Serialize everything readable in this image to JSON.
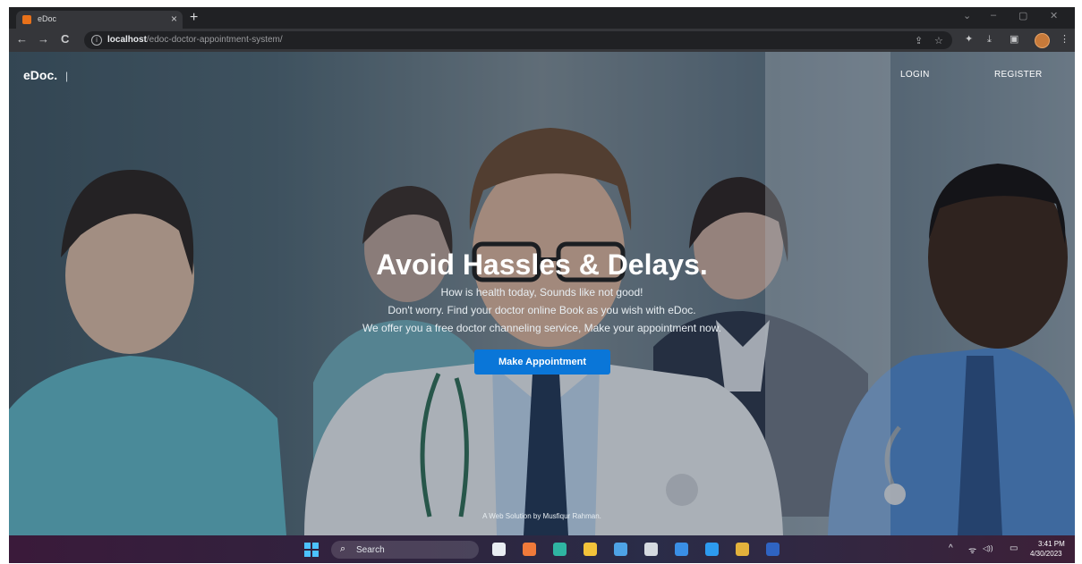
{
  "browser": {
    "tab": {
      "title": "eDoc",
      "close_glyph": "×"
    },
    "new_tab_glyph": "+",
    "window_controls": [
      "⌄",
      "–",
      "▢",
      "✕"
    ],
    "nav": {
      "back_glyph": "←",
      "forward_glyph": "→",
      "reload_glyph": "C"
    },
    "url": {
      "host": "localhost",
      "path": "/edoc-doctor-appointment-system/"
    },
    "toolbar_icons": [
      "share-icon",
      "star-icon",
      "extensions-icon",
      "download-icon",
      "sidebar-icon",
      "profile-avatar",
      "menu-icon"
    ]
  },
  "site": {
    "brand": "eDoc.",
    "brand_separator": "|",
    "nav": {
      "login": "LOGIN",
      "register": "REGISTER"
    },
    "hero": {
      "title": "Avoid Hassles & Delays.",
      "lines": [
        "How is health today, Sounds like not good!",
        "Don't worry. Find your doctor online Book as you wish with eDoc.",
        "We offer you a free doctor channeling service, Make your appointment now."
      ],
      "cta_label": "Make Appointment"
    },
    "footer_credit": "A Web Solution by Musfiqur Rahman."
  },
  "taskbar": {
    "search_label": "Search",
    "apps": [
      {
        "name": "file-app-icon",
        "color": "#e9edf2"
      },
      {
        "name": "orange-app-icon",
        "color": "#f07a3a"
      },
      {
        "name": "edge-icon",
        "color": "#2fb5a2"
      },
      {
        "name": "file-explorer-icon",
        "color": "#f3c33a"
      },
      {
        "name": "mail-icon",
        "color": "#4ea3e6"
      },
      {
        "name": "calendar-icon",
        "color": "#d5dae0"
      },
      {
        "name": "blue-app-icon",
        "color": "#3a8fe6"
      },
      {
        "name": "vscode-icon",
        "color": "#2d9bf0"
      },
      {
        "name": "chrome-icon",
        "color": "#e3b23c"
      },
      {
        "name": "word-icon",
        "color": "#2f64c2"
      }
    ],
    "tray": {
      "chevron": "^",
      "network_glyph": "ᯤ",
      "volume_glyph": "◁))",
      "battery_glyph": "▭"
    },
    "time": "3:41 PM",
    "date": "4/30/2023"
  },
  "colors": {
    "accent": "#0a76d8",
    "browser_dark": "#202124",
    "browser_toolbar": "#35363a"
  }
}
